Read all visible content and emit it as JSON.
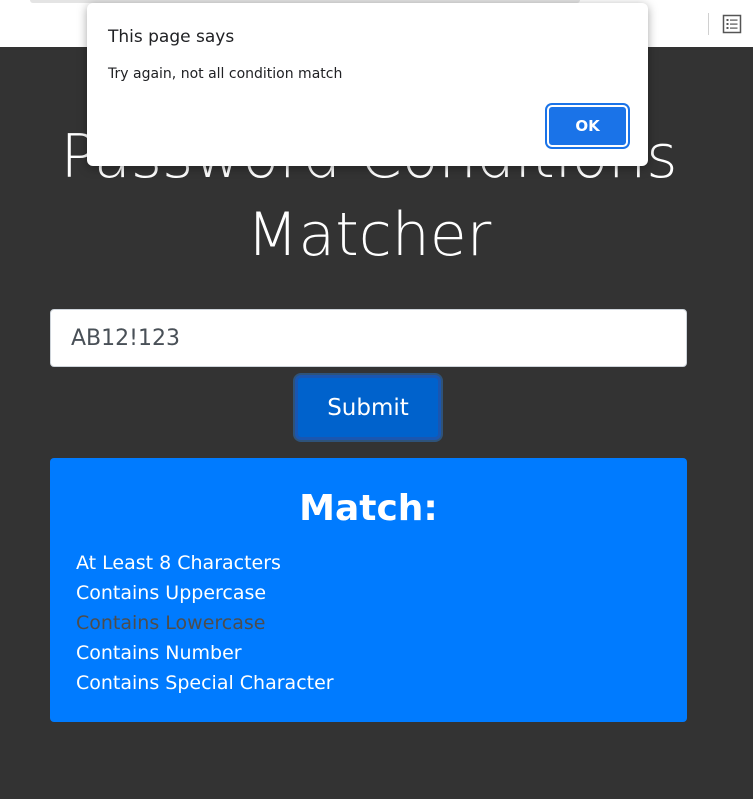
{
  "page": {
    "title_line1": "Password Conditions",
    "title_line2": "Matcher"
  },
  "password_input": {
    "value": "AB12!123"
  },
  "submit_button": {
    "label": "Submit"
  },
  "match_panel": {
    "heading": "Match:",
    "conditions": [
      {
        "label": "At Least 8 Characters",
        "met": true
      },
      {
        "label": "Contains Uppercase",
        "met": true
      },
      {
        "label": "Contains Lowercase",
        "met": false
      },
      {
        "label": "Contains Number",
        "met": true
      },
      {
        "label": "Contains Special Character",
        "met": true
      }
    ]
  },
  "alert": {
    "title": "This page says",
    "message": "Try again, not all condition match",
    "ok_label": "OK"
  },
  "colors": {
    "page_background": "#333333",
    "panel_accent": "#007bff",
    "button_primary": "#0062cc",
    "unmet_condition_text": "#4d4d4d",
    "dialog_button": "#1a73e8"
  },
  "icons": {
    "browser_toolbar": "reader-mode-icon"
  }
}
